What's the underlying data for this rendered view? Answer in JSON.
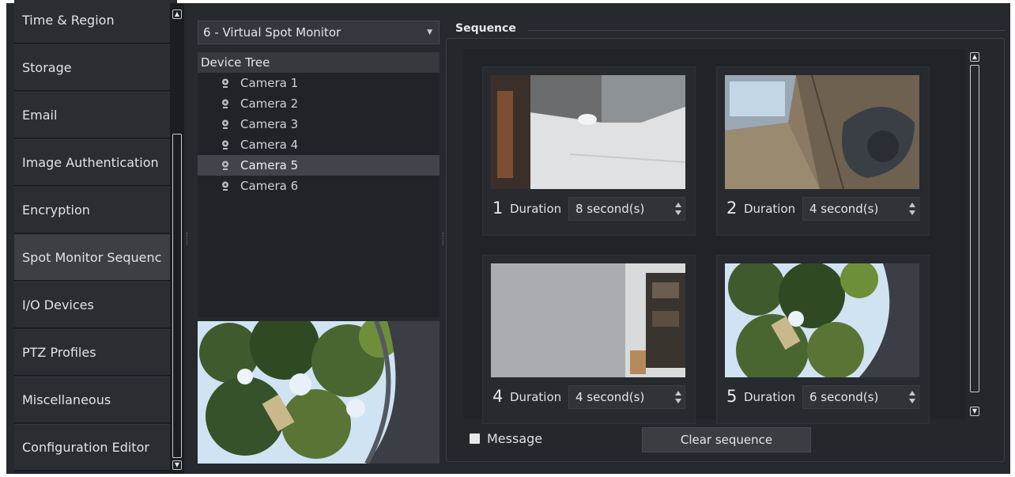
{
  "nav": {
    "items": [
      {
        "label": "Time & Region"
      },
      {
        "label": "Storage"
      },
      {
        "label": "Email"
      },
      {
        "label": "Image Authentication"
      },
      {
        "label": "Encryption"
      },
      {
        "label": "Spot Monitor Sequenc"
      },
      {
        "label": "I/O Devices"
      },
      {
        "label": "PTZ Profiles"
      },
      {
        "label": "Miscellaneous"
      },
      {
        "label": "Configuration Editor"
      }
    ],
    "active_index": 5
  },
  "monitor_select": {
    "value": "6 - Virtual Spot Monitor"
  },
  "device_tree": {
    "header": "Device Tree",
    "items": [
      {
        "label": "Camera 1"
      },
      {
        "label": "Camera 2"
      },
      {
        "label": "Camera 3"
      },
      {
        "label": "Camera 4"
      },
      {
        "label": "Camera 5"
      },
      {
        "label": "Camera 6"
      }
    ],
    "selected_index": 4
  },
  "sequence": {
    "title": "Sequence",
    "duration_label": "Duration",
    "slots": [
      {
        "number": "1",
        "duration": "8 second(s)"
      },
      {
        "number": "2",
        "duration": "4 second(s)"
      },
      {
        "number": "4",
        "duration": "4 second(s)"
      },
      {
        "number": "5",
        "duration": "6 second(s)"
      }
    ],
    "message_label": "Message",
    "message_checked": false,
    "clear_button": "Clear sequence"
  },
  "icons": {
    "camera": "webcam-icon",
    "scroll_up": "arrow-up-icon",
    "scroll_down": "arrow-down-icon",
    "dropdown": "chevron-down-icon",
    "spin": "spin-arrows-icon"
  }
}
